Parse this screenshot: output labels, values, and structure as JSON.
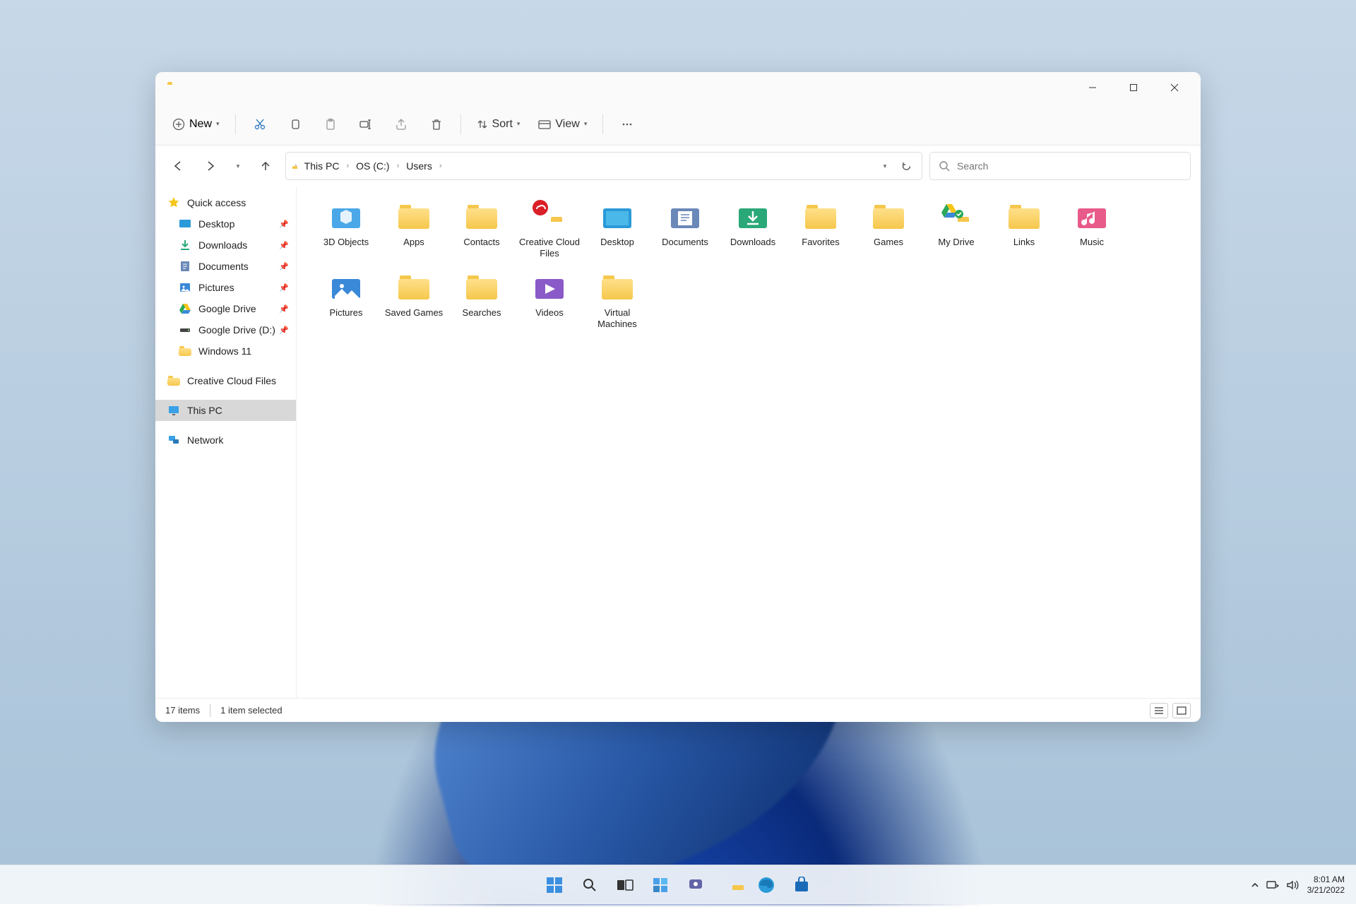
{
  "toolbar": {
    "new_label": "New",
    "sort_label": "Sort",
    "view_label": "View"
  },
  "breadcrumb": {
    "segments": [
      "This PC",
      "OS (C:)",
      "Users"
    ]
  },
  "search": {
    "placeholder": "Search"
  },
  "sidebar": {
    "quick_access": "Quick access",
    "items": [
      {
        "label": "Desktop",
        "pinned": true,
        "icon": "desktop"
      },
      {
        "label": "Downloads",
        "pinned": true,
        "icon": "downloads"
      },
      {
        "label": "Documents",
        "pinned": true,
        "icon": "documents"
      },
      {
        "label": "Pictures",
        "pinned": true,
        "icon": "pictures"
      },
      {
        "label": "Google Drive",
        "pinned": true,
        "icon": "gdrive"
      },
      {
        "label": "Google Drive (D:)",
        "pinned": true,
        "icon": "drive"
      },
      {
        "label": "Windows 11",
        "pinned": false,
        "icon": "folder"
      }
    ],
    "creative_cloud": "Creative Cloud Files",
    "this_pc": "This PC",
    "network": "Network"
  },
  "content": {
    "items": [
      {
        "label": "3D Objects",
        "icon": "3d"
      },
      {
        "label": "Apps",
        "icon": "folder"
      },
      {
        "label": "Contacts",
        "icon": "folder"
      },
      {
        "label": "Creative Cloud Files",
        "icon": "ccloud"
      },
      {
        "label": "Desktop",
        "icon": "desktop"
      },
      {
        "label": "Documents",
        "icon": "documents"
      },
      {
        "label": "Downloads",
        "icon": "downloads"
      },
      {
        "label": "Favorites",
        "icon": "folder"
      },
      {
        "label": "Games",
        "icon": "folder"
      },
      {
        "label": "My Drive",
        "icon": "gdrive"
      },
      {
        "label": "Links",
        "icon": "folder"
      },
      {
        "label": "Music",
        "icon": "music"
      },
      {
        "label": "Pictures",
        "icon": "pictures"
      },
      {
        "label": "Saved Games",
        "icon": "folder"
      },
      {
        "label": "Searches",
        "icon": "folder"
      },
      {
        "label": "Videos",
        "icon": "videos"
      },
      {
        "label": "Virtual Machines",
        "icon": "folder"
      }
    ]
  },
  "status": {
    "count": "17 items",
    "selected": "1 item selected"
  },
  "tray": {
    "time": "8:01 AM",
    "date": "3/21/2022"
  }
}
